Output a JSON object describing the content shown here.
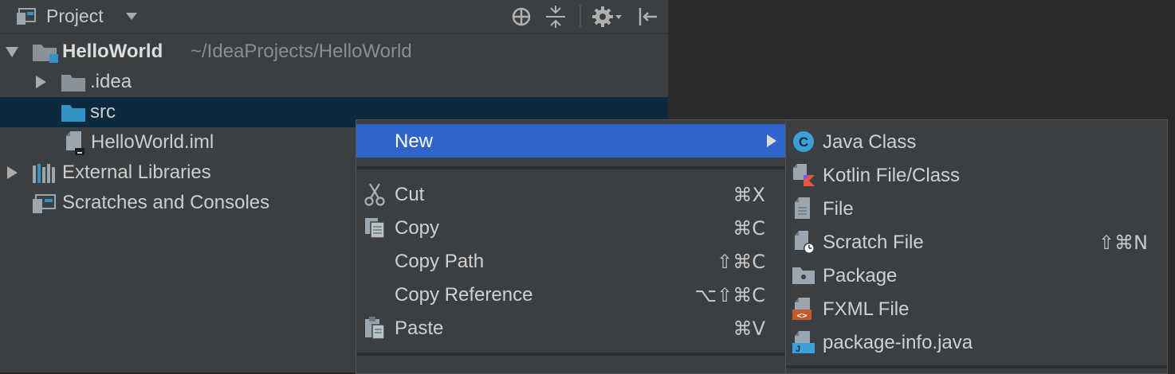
{
  "header": {
    "title": "Project"
  },
  "tree": {
    "root": {
      "name": "HelloWorld",
      "path": "~/IdeaProjects/HelloWorld"
    },
    "items": [
      {
        "label": ".idea"
      },
      {
        "label": "src"
      },
      {
        "label": "HelloWorld.iml"
      },
      {
        "label": "External Libraries"
      },
      {
        "label": "Scratches and Consoles"
      }
    ]
  },
  "menu": {
    "items": [
      {
        "label": "New",
        "shortcut": ""
      },
      {
        "label": "Cut",
        "shortcut": "⌘X"
      },
      {
        "label": "Copy",
        "shortcut": "⌘C"
      },
      {
        "label": "Copy Path",
        "shortcut": "⇧⌘C"
      },
      {
        "label": "Copy Reference",
        "shortcut": "⌥⇧⌘C"
      },
      {
        "label": "Paste",
        "shortcut": "⌘V"
      }
    ]
  },
  "submenu": {
    "items": [
      {
        "label": "Java Class",
        "shortcut": "",
        "icon_letter": "C"
      },
      {
        "label": "Kotlin File/Class",
        "shortcut": ""
      },
      {
        "label": "File",
        "shortcut": ""
      },
      {
        "label": "Scratch File",
        "shortcut": "⇧⌘N"
      },
      {
        "label": "Package",
        "shortcut": ""
      },
      {
        "label": "FXML File",
        "shortcut": "",
        "icon_text": "<>"
      },
      {
        "label": "package-info.java",
        "shortcut": "",
        "icon_text": "J"
      }
    ]
  },
  "colors": {
    "panel_bg": "#3c3f41",
    "editor_bg": "#2b2b2b",
    "selection": "#0d293e",
    "menu_active": "#2f65ca",
    "folder": "#8a9198",
    "src_folder": "#3592c4",
    "java_class": "#3aa0d7",
    "fxml": "#c7582a"
  },
  "icons": [
    "project-icon",
    "locate-icon",
    "collapse-all-icon",
    "gear-icon",
    "hide-icon",
    "folder-icon",
    "module-icon",
    "file-icon",
    "libraries-icon",
    "scratches-icon",
    "scissors-icon",
    "copy-icon",
    "paste-icon",
    "java-class-icon",
    "kotlin-icon",
    "scratch-file-icon",
    "package-icon",
    "fxml-icon",
    "package-info-icon"
  ]
}
